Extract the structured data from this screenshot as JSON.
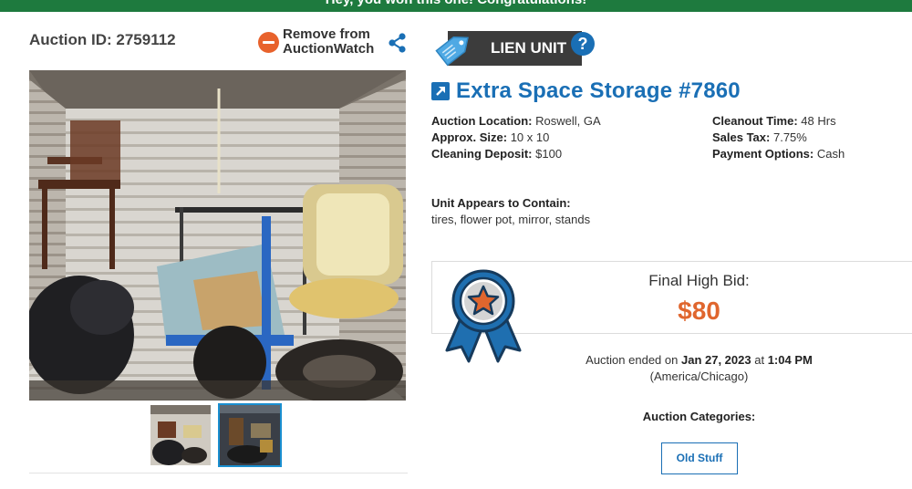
{
  "banner": {
    "message": "Hey, you won this one! Congratulations!"
  },
  "auction": {
    "id_label": "Auction ID: 2759112",
    "remove_watch_label": "Remove from AuctionWatch"
  },
  "unit": {
    "tag_label": "LIEN UNIT",
    "help_glyph": "?",
    "title": "Extra Space Storage #7860"
  },
  "details": {
    "location_key": "Auction Location:",
    "location_value": "Roswell, GA",
    "size_key": "Approx. Size:",
    "size_value": "10 x 10",
    "deposit_key": "Cleaning Deposit:",
    "deposit_value": "$100",
    "cleanout_key": "Cleanout Time:",
    "cleanout_value": "48 Hrs",
    "tax_key": "Sales Tax:",
    "tax_value": "7.75%",
    "payment_key": "Payment Options:",
    "payment_value": "Cash"
  },
  "contents": {
    "label": "Unit Appears to Contain:",
    "value": "tires, flower pot, mirror, stands"
  },
  "bid": {
    "label": "Final High Bid:",
    "value": "$80"
  },
  "ended": {
    "prefix": "Auction ended on",
    "date": "Jan 27, 2023",
    "at": "at",
    "time": "1:04 PM",
    "timezone": "(America/Chicago)"
  },
  "categories": {
    "label": "Auction Categories:",
    "items": [
      "Old Stuff"
    ]
  },
  "colors": {
    "banner_green": "#1e7a3e",
    "brand_blue": "#1a6fb5",
    "bid_orange": "#e0662e",
    "remove_orange": "#e8622c",
    "tag_dark": "#3c3c3c"
  },
  "icons": {
    "remove": "minus-circle-icon",
    "share": "share-icon",
    "tag": "price-tag-icon",
    "help": "question-circle-icon",
    "external": "external-link-icon",
    "award": "award-ribbon-icon"
  }
}
